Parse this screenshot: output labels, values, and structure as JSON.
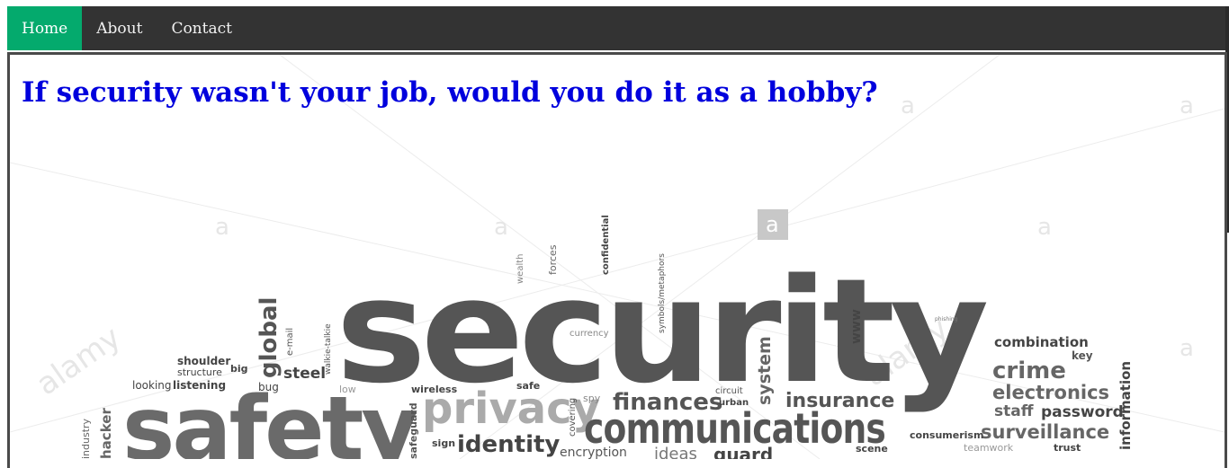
{
  "nav": {
    "items": [
      {
        "label": "Home",
        "active": true
      },
      {
        "label": "About",
        "active": false
      },
      {
        "label": "Contact",
        "active": false
      }
    ]
  },
  "hero": {
    "title": "If security wasn't your job, would you do it as a hobby?"
  },
  "wordcloud": {
    "words": {
      "security": "security",
      "safety": "safety",
      "privacy": "privacy",
      "communications": "communications",
      "identity": "identity",
      "finances": "finances",
      "insurance": "insurance",
      "crime": "crime",
      "electronics": "electronics",
      "combination": "combination",
      "key": "key",
      "staff": "staff",
      "password": "password",
      "surveillance": "surveillance",
      "information": "information",
      "global": "global",
      "steel": "steel",
      "shoulder": "shoulder",
      "structure": "structure",
      "big": "big",
      "looking": "looking",
      "listening": "listening",
      "bug": "bug",
      "email": "e-mail",
      "walkie": "walkie-talkie",
      "system": "system",
      "www": "www",
      "wealth": "wealth",
      "forces": "forces",
      "confidential": "confidential",
      "symbols": "symbols/metaphors",
      "currency": "currency",
      "wireless": "wireless",
      "safe": "safe",
      "low": "low",
      "spy": "spy",
      "circuit": "circuit",
      "urban": "urban",
      "encryption": "encryption",
      "ideas": "ideas",
      "guard": "guard",
      "scene": "scene",
      "consumerism": "consumerism",
      "teamwork": "teamwork",
      "trust": "trust",
      "sign": "sign",
      "safeguard": "safeguard",
      "covering": "covering",
      "hacker": "hacker",
      "industry": "industry",
      "phishing": "phishing"
    },
    "watermark": "alamy",
    "watermark_mark": "a"
  }
}
